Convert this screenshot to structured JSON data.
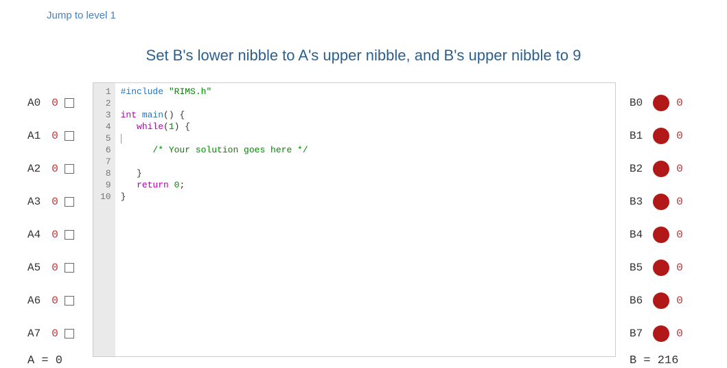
{
  "jump_label": "Jump to level 1",
  "instruction": "Set B's lower nibble to A's upper nibble, and B's upper nibble to 9",
  "inputs": {
    "rows": [
      {
        "label": "A0",
        "val": "0"
      },
      {
        "label": "A1",
        "val": "0"
      },
      {
        "label": "A2",
        "val": "0"
      },
      {
        "label": "A3",
        "val": "0"
      },
      {
        "label": "A4",
        "val": "0"
      },
      {
        "label": "A5",
        "val": "0"
      },
      {
        "label": "A6",
        "val": "0"
      },
      {
        "label": "A7",
        "val": "0"
      }
    ],
    "total_label": "A = 0"
  },
  "outputs": {
    "rows": [
      {
        "label": "B0",
        "val": "0"
      },
      {
        "label": "B1",
        "val": "0"
      },
      {
        "label": "B2",
        "val": "0"
      },
      {
        "label": "B3",
        "val": "0"
      },
      {
        "label": "B4",
        "val": "0"
      },
      {
        "label": "B5",
        "val": "0"
      },
      {
        "label": "B6",
        "val": "0"
      },
      {
        "label": "B7",
        "val": "0"
      }
    ],
    "total_label": "B = 216"
  },
  "editor": {
    "gutter": [
      "1",
      "2",
      "3",
      "4",
      "5",
      "6",
      "7",
      "8",
      "9",
      "10"
    ],
    "code": {
      "l1_include": "#include",
      "l1_str": "\"RIMS.h\"",
      "l3_int": "int",
      "l3_main": "main",
      "l4_while": "while",
      "l4_one": "1",
      "l6_comment": "/* Your solution goes here */",
      "l9_return": "return",
      "l9_zero": "0"
    }
  }
}
